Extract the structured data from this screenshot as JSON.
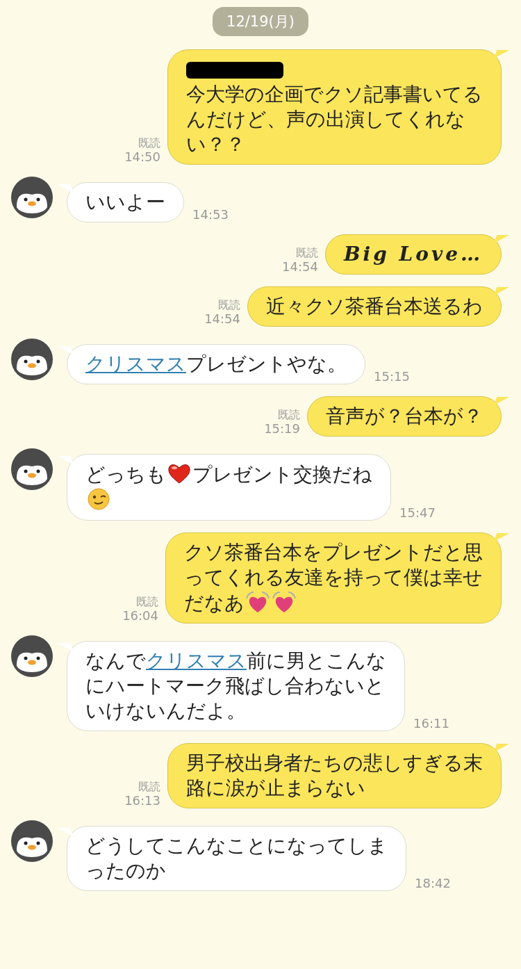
{
  "date_label": "12/19(月)",
  "messages": [
    {
      "kind": "sent",
      "read_label": "既読",
      "time": "14:50",
      "lines": [
        [
          {
            "kind": "redacted"
          }
        ],
        [
          {
            "kind": "text",
            "text": "今大学の企画でクソ記事書いてる"
          }
        ],
        [
          {
            "kind": "text",
            "text": "んだけど、声の出演してくれな"
          }
        ],
        [
          {
            "kind": "text",
            "text": "い？？"
          }
        ]
      ]
    },
    {
      "kind": "received",
      "time": "14:53",
      "lines": [
        [
          {
            "kind": "text",
            "text": "いいよー"
          }
        ]
      ]
    },
    {
      "kind": "sent",
      "read_label": "既読",
      "time": "14:54",
      "lines": [
        [
          {
            "kind": "script",
            "text": "Big Love…"
          }
        ]
      ]
    },
    {
      "kind": "sent",
      "read_label": "既読",
      "time": "14:54",
      "lines": [
        [
          {
            "kind": "text",
            "text": "近々クソ茶番台本送るわ"
          }
        ]
      ]
    },
    {
      "kind": "received",
      "time": "15:15",
      "lines": [
        [
          {
            "kind": "link",
            "text": "クリスマス"
          },
          {
            "kind": "text",
            "text": "プレゼントやな。"
          }
        ]
      ]
    },
    {
      "kind": "sent",
      "read_label": "既読",
      "time": "15:19",
      "lines": [
        [
          {
            "kind": "text",
            "text": "音声が？台本が？"
          }
        ]
      ]
    },
    {
      "kind": "received",
      "time": "15:47",
      "lines": [
        [
          {
            "kind": "text",
            "text": "どっちも"
          },
          {
            "kind": "heart"
          },
          {
            "kind": "text",
            "text": "プレゼント交換だね"
          }
        ],
        [
          {
            "kind": "wink"
          }
        ]
      ]
    },
    {
      "kind": "sent",
      "read_label": "既読",
      "time": "16:04",
      "lines": [
        [
          {
            "kind": "text",
            "text": "クソ茶番台本をプレゼントだと思"
          }
        ],
        [
          {
            "kind": "text",
            "text": "ってくれる友達を持って僕は幸せ"
          }
        ],
        [
          {
            "kind": "text",
            "text": "だなあ"
          },
          {
            "kind": "beating-heart"
          },
          {
            "kind": "beating-heart"
          }
        ]
      ]
    },
    {
      "kind": "received",
      "time": "16:11",
      "lines": [
        [
          {
            "kind": "text",
            "text": "なんで"
          },
          {
            "kind": "link",
            "text": "クリスマス"
          },
          {
            "kind": "text",
            "text": "前に男とこんな"
          }
        ],
        [
          {
            "kind": "text",
            "text": "にハートマーク飛ばし合わないと"
          }
        ],
        [
          {
            "kind": "text",
            "text": "いけないんだよ。"
          }
        ]
      ]
    },
    {
      "kind": "sent",
      "read_label": "既読",
      "time": "16:13",
      "lines": [
        [
          {
            "kind": "text",
            "text": "男子校出身者たちの悲しすぎる末"
          }
        ],
        [
          {
            "kind": "text",
            "text": "路に涙が止まらない"
          }
        ]
      ]
    },
    {
      "kind": "received",
      "time": "18:42",
      "lines": [
        [
          {
            "kind": "text",
            "text": "どうしてこんなことになってしま"
          }
        ],
        [
          {
            "kind": "text",
            "text": "ったのか"
          }
        ]
      ]
    }
  ]
}
